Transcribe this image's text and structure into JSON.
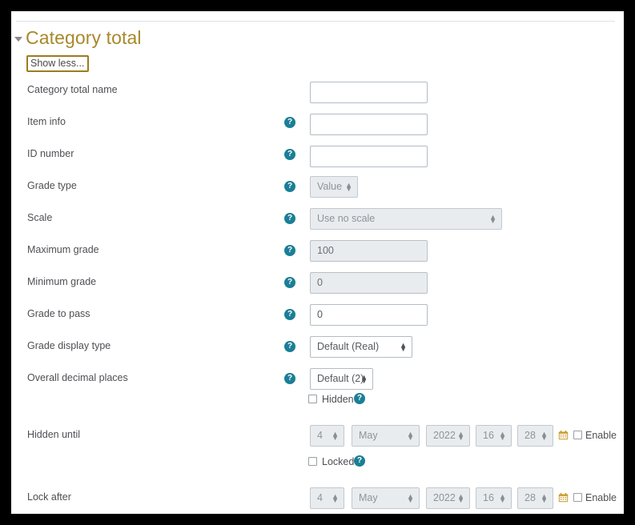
{
  "section": {
    "title": "Category total",
    "caret_icon": "chevron-down-icon",
    "show_less_label": "Show less..."
  },
  "help_icon": "help-circle-icon",
  "calendar_icon": "calendar-icon",
  "colors": {
    "heading": "#a8882c",
    "help_icon_bg": "#1a7f96",
    "focus_outline": "#9a7d1e",
    "calendar_icon": "#c89b2a",
    "disabled_bg": "#e9ecef",
    "input_border": "#b3bcc4",
    "label_text": "#4d4f53"
  },
  "fields": {
    "category_total_name": {
      "label": "Category total name",
      "value": "",
      "disabled": false,
      "has_help": false
    },
    "item_info": {
      "label": "Item info",
      "value": "",
      "disabled": false,
      "has_help": true
    },
    "id_number": {
      "label": "ID number",
      "value": "",
      "disabled": false,
      "has_help": true
    },
    "grade_type": {
      "label": "Grade type",
      "value": "Value",
      "disabled": true,
      "has_help": true
    },
    "scale": {
      "label": "Scale",
      "value": "Use no scale",
      "disabled": true,
      "has_help": true
    },
    "maximum_grade": {
      "label": "Maximum grade",
      "value": "100",
      "disabled": true,
      "has_help": true
    },
    "minimum_grade": {
      "label": "Minimum grade",
      "value": "0",
      "disabled": true,
      "has_help": true
    },
    "grade_to_pass": {
      "label": "Grade to pass",
      "value": "0",
      "disabled": false,
      "has_help": true
    },
    "grade_display_type": {
      "label": "Grade display type",
      "value": "Default (Real)",
      "disabled": false,
      "has_help": true
    },
    "overall_decimal_places": {
      "label": "Overall decimal places",
      "value": "Default (2)",
      "disabled": false,
      "has_help": true
    },
    "hidden": {
      "label": "Hidden",
      "checked": false,
      "has_help": true
    },
    "hidden_until": {
      "label": "Hidden until"
    },
    "locked": {
      "label": "Locked",
      "checked": false,
      "has_help": true
    },
    "lock_after": {
      "label": "Lock after"
    }
  },
  "date_selectors": {
    "hidden_until": {
      "day": "4",
      "month": "May",
      "year": "2022",
      "hour": "16",
      "minute": "28",
      "enable_label": "Enable",
      "enable_checked": false,
      "disabled": true
    },
    "lock_after": {
      "day": "4",
      "month": "May",
      "year": "2022",
      "hour": "16",
      "minute": "28",
      "enable_label": "Enable",
      "enable_checked": false,
      "disabled": true
    }
  }
}
